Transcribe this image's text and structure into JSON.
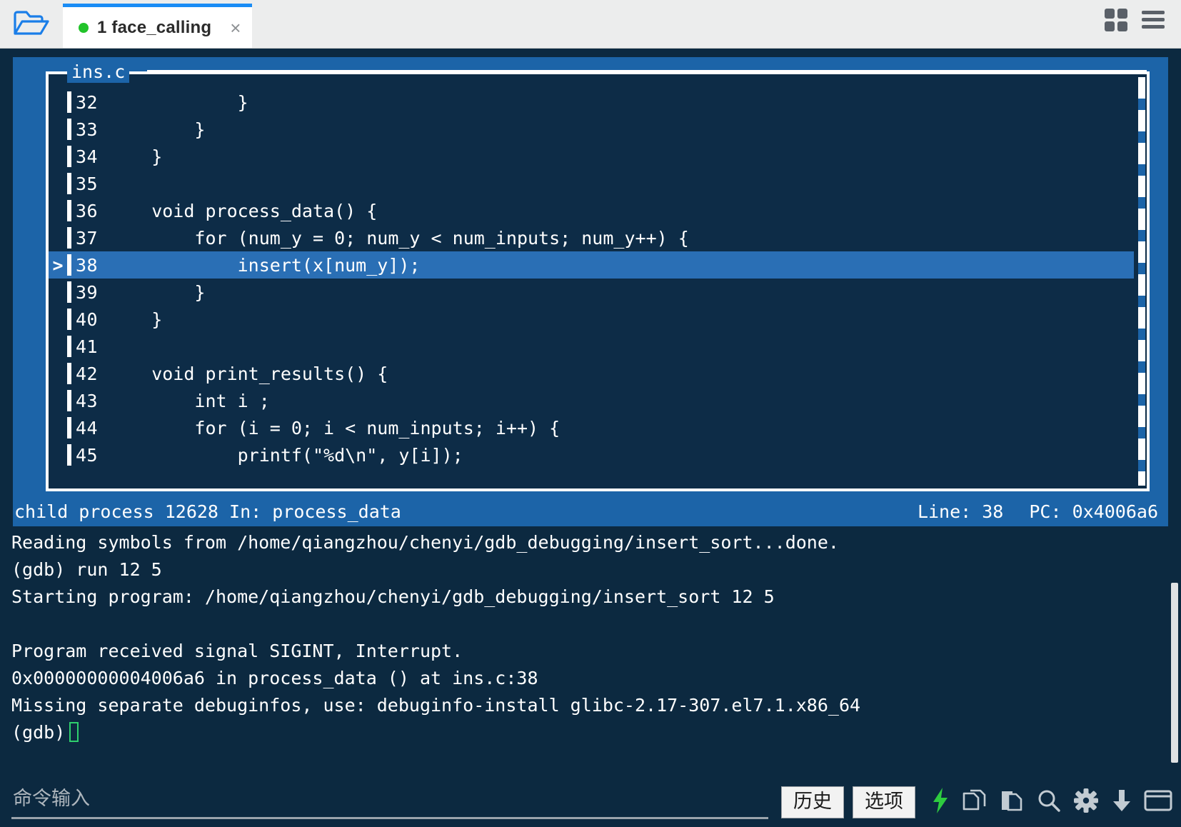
{
  "window": {
    "folder_icon": "open-folder-icon",
    "grid_icon": "grid-view-icon",
    "menu_icon": "hamburger-menu-icon"
  },
  "tab": {
    "index": "1",
    "title": "1  face_calling",
    "close_label": "×",
    "status_dot_color": "#22c32a",
    "accent_color": "#1a8cf5"
  },
  "source": {
    "filename": "ins.c",
    "current_line": 38,
    "marker": ">",
    "lines": [
      {
        "no": "32",
        "text": "            }",
        "current": false
      },
      {
        "no": "33",
        "text": "        }",
        "current": false
      },
      {
        "no": "34",
        "text": "    }",
        "current": false
      },
      {
        "no": "35",
        "text": "",
        "current": false
      },
      {
        "no": "36",
        "text": "    void process_data() {",
        "current": false
      },
      {
        "no": "37",
        "text": "        for (num_y = 0; num_y < num_inputs; num_y++) {",
        "current": false
      },
      {
        "no": "38",
        "text": "            insert(x[num_y]);",
        "current": true
      },
      {
        "no": "39",
        "text": "        }",
        "current": false
      },
      {
        "no": "40",
        "text": "    }",
        "current": false
      },
      {
        "no": "41",
        "text": "",
        "current": false
      },
      {
        "no": "42",
        "text": "    void print_results() {",
        "current": false
      },
      {
        "no": "43",
        "text": "        int i ;",
        "current": false
      },
      {
        "no": "44",
        "text": "        for (i = 0; i < num_inputs; i++) {",
        "current": false
      },
      {
        "no": "45",
        "text": "            printf(\"%d\\n\", y[i]);",
        "current": false
      }
    ]
  },
  "status": {
    "left": "child process 12628 In: process_data",
    "line": "Line: 38",
    "pc": "PC: 0x4006a6"
  },
  "console": {
    "lines": [
      "Reading symbols from /home/qiangzhou/chenyi/gdb_debugging/insert_sort...done.",
      "(gdb) run 12 5",
      "Starting program: /home/qiangzhou/chenyi/gdb_debugging/insert_sort 12 5",
      "",
      "Program received signal SIGINT, Interrupt.",
      "0x00000000004006a6 in process_data () at ins.c:38",
      "Missing separate debuginfos, use: debuginfo-install glibc-2.17-307.el7.1.x86_64"
    ],
    "prompt": "(gdb)",
    "cursor_color": "#2ecf6d"
  },
  "bottom": {
    "input_value": "",
    "input_placeholder": "命令输入",
    "history_button": "历史",
    "options_button": "选项",
    "icons": [
      "lightning-bolt-icon",
      "copy-icon",
      "paste-icon",
      "search-icon",
      "gear-icon",
      "download-arrow-icon",
      "window-icon"
    ],
    "bolt_color": "#2ecb3f"
  },
  "colors": {
    "panel_blue": "#1c64a8",
    "code_bg": "#0d2c47",
    "app_bg": "#0c2940",
    "highlight": "#2a6fb5"
  }
}
